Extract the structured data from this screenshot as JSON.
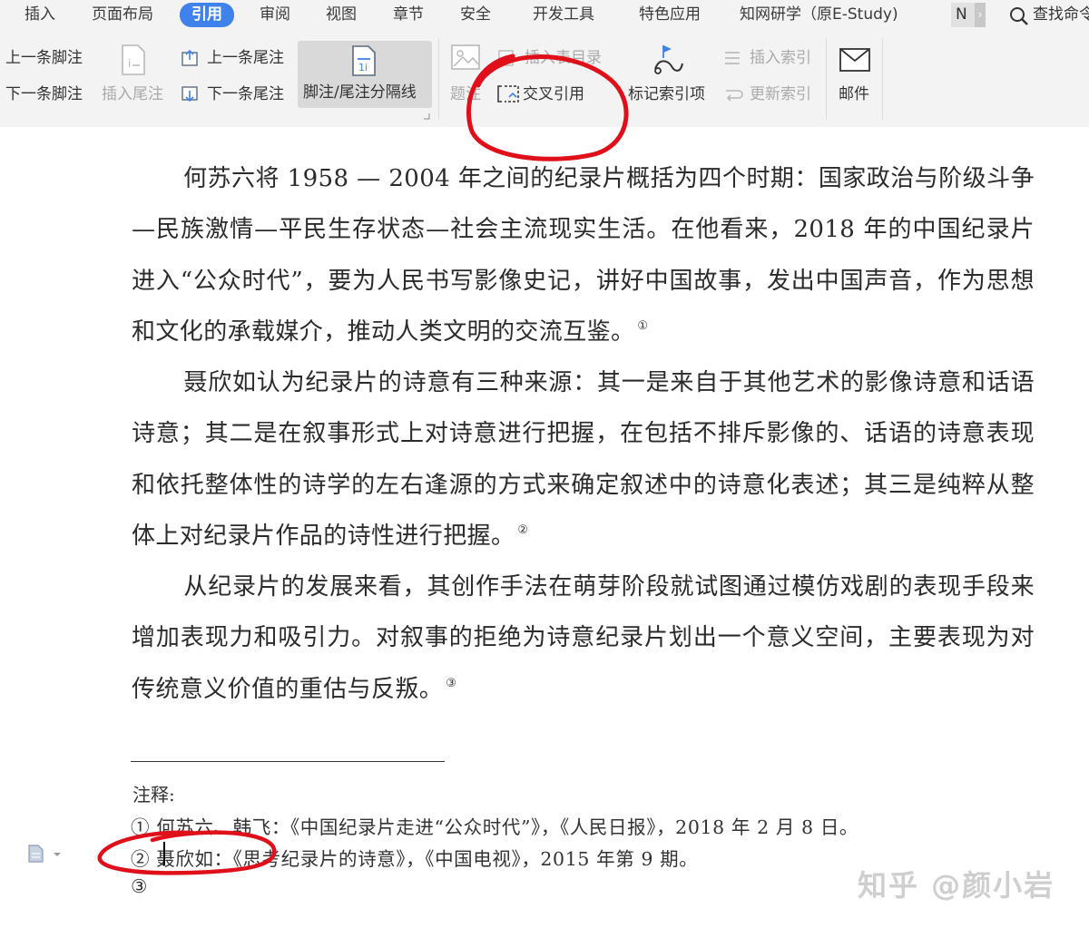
{
  "menu_tabs": [
    {
      "label": "插入"
    },
    {
      "label": "页面布局"
    },
    {
      "label": "引用",
      "active": true
    },
    {
      "label": "审阅"
    },
    {
      "label": "视图"
    },
    {
      "label": "章节"
    },
    {
      "label": "安全"
    },
    {
      "label": "开发工具"
    },
    {
      "label": "特色应用"
    },
    {
      "label": "知网研学（原E-Study)"
    }
  ],
  "tab_more": "N",
  "search_label": "查找命令",
  "ribbon": {
    "next_footnote": "上一条脚注",
    "prev_footnote": "下一条脚注",
    "insert_endnote": "插入尾注",
    "prev_endnote": "上一条尾注",
    "next_endnote": "下一条尾注",
    "separator": "脚注/尾注分隔线",
    "insert_caption": "插入表目录",
    "caption": "题注",
    "cross_reference": "交叉引用",
    "mark_index": "标记索引项",
    "insert_index": "插入索引",
    "update_index": "更新索引",
    "mail": "邮件"
  },
  "document": {
    "paragraphs": [
      {
        "text": "何苏六将 1958 — 2004 年之间的纪录片概括为四个时期：国家政治与阶级斗争—民族激情—平民生存状态—社会主流现实生活。在他看来，2018 年的中国纪录片进入“公众时代”，要为人民书写影像史记，讲好中国故事，发出中国声音，作为思想和文化的承载媒介，推动人类文明的交流互鉴。",
        "note": "①"
      },
      {
        "text": "聂欣如认为纪录片的诗意有三种来源：其一是来自于其他艺术的影像诗意和话语诗意；其二是在叙事形式上对诗意进行把握，在包括不排斥影像的、话语的诗意表现和依托整体性的诗学的左右逢源的方式来确定叙述中的诗意化表述；其三是纯粹从整体上对纪录片作品的诗性进行把握。",
        "note": "②"
      },
      {
        "text": "从纪录片的发展来看，其创作手法在萌芽阶段就试图通过模仿戏剧的表现手段来增加表现力和吸引力。对叙事的拒绝为诗意纪录片划出一个意义空间，主要表现为对传统意义价值的重估与反叛。",
        "note": "③"
      }
    ],
    "footnote_title": "注释:",
    "footnotes": [
      "① 何苏六、韩飞：《中国纪录片走进“公众时代”》，《人民日报》，2018 年 2 月 8 日。",
      "② 聂欣如：《思考纪录片的诗意》，《中国电视》，2015 年第 9 期。",
      "③"
    ]
  },
  "watermark": "知乎 @颜小岩",
  "colors": {
    "accent": "#3f82ec",
    "annotation": "#e0101a",
    "ribbon_bg": "#f3f3f3"
  }
}
